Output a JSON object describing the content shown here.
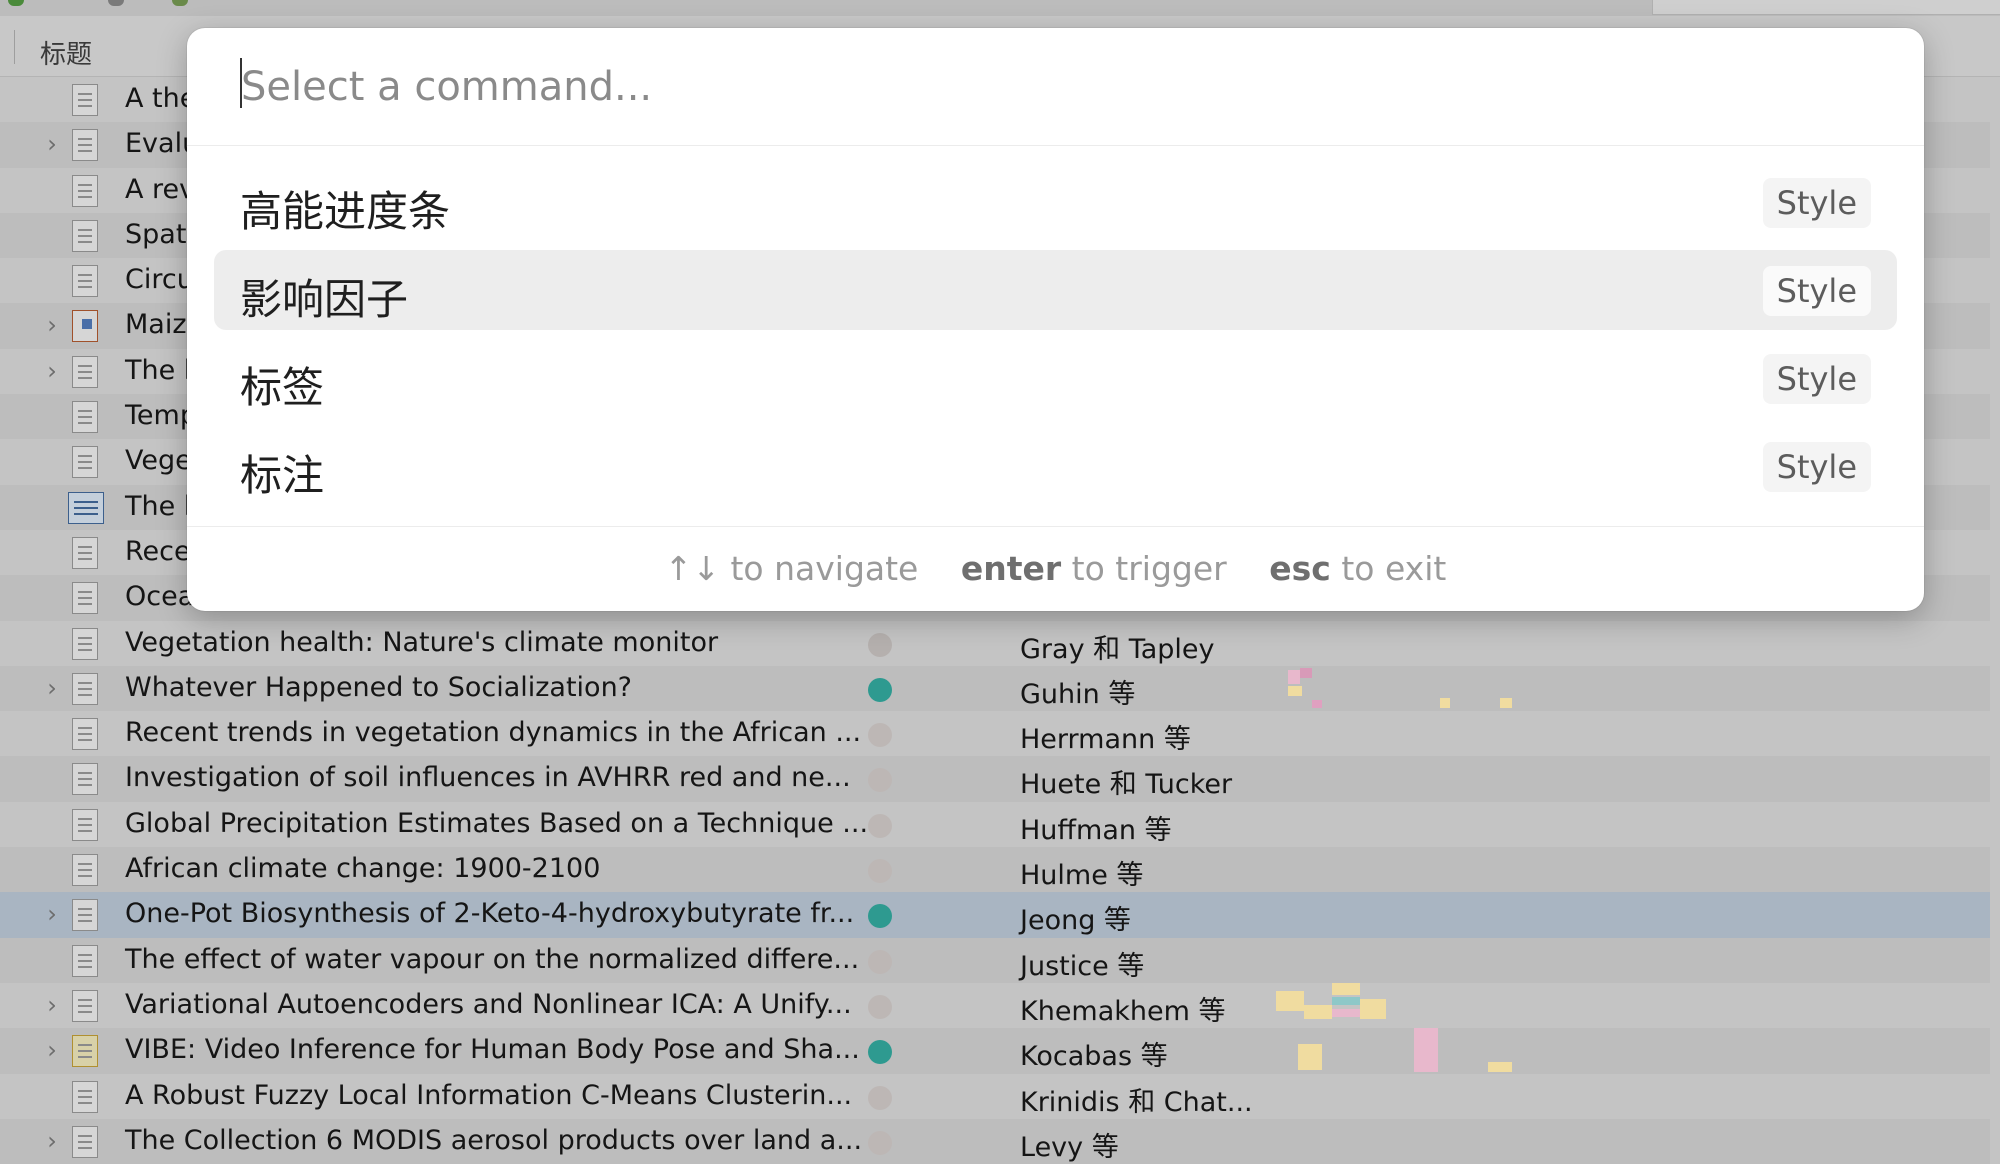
{
  "header": {
    "title_column": "标题"
  },
  "rows": [
    {
      "title": "A the",
      "creator": "",
      "status": "none",
      "chevron": false,
      "icon": "document-icon"
    },
    {
      "title": "Evalu",
      "creator": "",
      "status": "none",
      "chevron": true,
      "icon": "document-icon"
    },
    {
      "title": "A rev",
      "creator": "",
      "status": "none",
      "chevron": false,
      "icon": "document-icon"
    },
    {
      "title": "Spat",
      "creator": "",
      "status": "none",
      "chevron": false,
      "icon": "document-icon"
    },
    {
      "title": "Circu",
      "creator": "",
      "status": "none",
      "chevron": false,
      "icon": "document-icon"
    },
    {
      "title": "Maiz",
      "creator": "",
      "status": "none",
      "chevron": true,
      "icon": "presentation-icon"
    },
    {
      "title": "The l",
      "creator": "",
      "status": "none",
      "chevron": true,
      "icon": "document-icon"
    },
    {
      "title": "Temp",
      "creator": "",
      "status": "none",
      "chevron": false,
      "icon": "document-icon"
    },
    {
      "title": "Vege",
      "creator": "",
      "status": "none",
      "chevron": false,
      "icon": "document-icon"
    },
    {
      "title": "The l",
      "creator": "",
      "status": "none",
      "chevron": false,
      "icon": "book-icon"
    },
    {
      "title": "Rece",
      "creator": "",
      "status": "none",
      "chevron": false,
      "icon": "document-icon"
    },
    {
      "title": "Ocea",
      "creator": "",
      "status": "none",
      "chevron": false,
      "icon": "document-icon"
    },
    {
      "title": "Vegetation health: Nature's climate monitor",
      "creator": "Gray 和 Tapley",
      "status": "grey",
      "chevron": false,
      "icon": "document-icon"
    },
    {
      "title": "Whatever Happened to Socialization?",
      "creator": "Guhin 等",
      "status": "teal",
      "chevron": true,
      "icon": "document-icon"
    },
    {
      "title": "Recent trends in vegetation dynamics in the African ...",
      "creator": "Herrmann 等",
      "status": "dim",
      "chevron": false,
      "icon": "document-icon"
    },
    {
      "title": "Investigation of soil influences in AVHRR red and ne...",
      "creator": "Huete 和 Tucker",
      "status": "dim",
      "chevron": false,
      "icon": "document-icon"
    },
    {
      "title": "Global Precipitation Estimates Based on a Technique ...",
      "creator": "Huffman 等",
      "status": "dim",
      "chevron": false,
      "icon": "document-icon"
    },
    {
      "title": "African climate change: 1900-2100",
      "creator": "Hulme 等",
      "status": "dim",
      "chevron": false,
      "icon": "document-icon"
    },
    {
      "title": "One-Pot Biosynthesis of 2-Keto-4-hydroxybutyrate fr...",
      "creator": "Jeong 等",
      "status": "teal",
      "chevron": true,
      "icon": "document-icon",
      "selected": true
    },
    {
      "title": "The effect of water vapour on the normalized differe...",
      "creator": "Justice 等",
      "status": "dim",
      "chevron": false,
      "icon": "document-icon"
    },
    {
      "title": "Variational Autoencoders and Nonlinear ICA: A Unify...",
      "creator": "Khemakhem 等",
      "status": "dim",
      "chevron": true,
      "icon": "document-icon"
    },
    {
      "title": "VIBE: Video Inference for Human Body Pose and Sha...",
      "creator": "Kocabas 等",
      "status": "teal",
      "chevron": true,
      "icon": "note-icon"
    },
    {
      "title": "A Robust Fuzzy Local Information C-Means Clusterin...",
      "creator": "Krinidis 和 Chat...",
      "status": "dim",
      "chevron": false,
      "icon": "document-icon"
    },
    {
      "title": "The Collection 6 MODIS aerosol products over land a...",
      "creator": "Levy 等",
      "status": "dim",
      "chevron": true,
      "icon": "document-icon"
    }
  ],
  "palette": {
    "placeholder": "Select a command...",
    "value": "",
    "commands": [
      {
        "label": "高能进度条",
        "tag": "Style"
      },
      {
        "label": "影响因子",
        "tag": "Style"
      },
      {
        "label": "标签",
        "tag": "Style"
      },
      {
        "label": "标注",
        "tag": "Style"
      }
    ],
    "active_index": 1,
    "footer": {
      "nav_key": "↑↓",
      "nav_text": "to navigate",
      "enter_key": "enter",
      "enter_text": "to trigger",
      "esc_key": "esc",
      "esc_text": "to exit"
    }
  }
}
